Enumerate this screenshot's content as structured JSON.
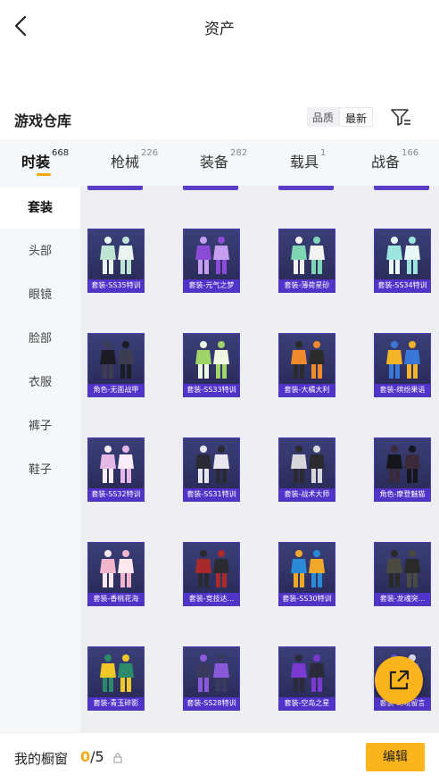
{
  "header": {
    "title": "资产",
    "back_icon": "chevron-left-icon"
  },
  "warehouse": {
    "title": "游戏仓库",
    "sort_options": [
      "品质",
      "最新"
    ],
    "active_sort": "最新",
    "filter_icon": "filter-icon"
  },
  "tabs": [
    {
      "label": "时装",
      "count": "668",
      "active": true
    },
    {
      "label": "枪械",
      "count": "226",
      "active": false
    },
    {
      "label": "装备",
      "count": "282",
      "active": false
    },
    {
      "label": "载具",
      "count": "1",
      "active": false
    },
    {
      "label": "战备",
      "count": "166",
      "active": false
    }
  ],
  "sidebar": {
    "items": [
      {
        "label": "套装",
        "active": true
      },
      {
        "label": "头部"
      },
      {
        "label": "眼镜"
      },
      {
        "label": "脸部"
      },
      {
        "label": "衣服"
      },
      {
        "label": "裤子"
      },
      {
        "label": "鞋子"
      }
    ]
  },
  "items": [
    {
      "label": "套装-SS35特训",
      "palette": [
        "#bfe4d4",
        "#e9f4f0"
      ]
    },
    {
      "label": "套装-元气之梦",
      "palette": [
        "#8b4bd6",
        "#c69ef0"
      ]
    },
    {
      "label": "套装-薄荷星砂",
      "palette": [
        "#7ed6b4",
        "#f2f2f2"
      ]
    },
    {
      "label": "套装-SS34特训",
      "palette": [
        "#9be7e0",
        "#e8f8f6"
      ]
    },
    {
      "label": "角色-无面战甲",
      "palette": [
        "#1c1c24",
        "#3c3c52"
      ]
    },
    {
      "label": "套装-SS33特训",
      "palette": [
        "#9fd46a",
        "#eef6e4"
      ]
    },
    {
      "label": "套装-大橘大利",
      "palette": [
        "#f08a2a",
        "#2b2b2b"
      ]
    },
    {
      "label": "套装-缤纷果语",
      "palette": [
        "#f4b42a",
        "#3a78d8"
      ]
    },
    {
      "label": "套装-SS32特训",
      "palette": [
        "#e6b8e6",
        "#fbeefb"
      ]
    },
    {
      "label": "套装-SS31特训",
      "palette": [
        "#2a2a34",
        "#e8e8ee"
      ]
    },
    {
      "label": "套装-战术大师",
      "palette": [
        "#d8d8dc",
        "#2a2a30"
      ]
    },
    {
      "label": "角色-摩登魅猫",
      "palette": [
        "#15151c",
        "#3a2a3a"
      ]
    },
    {
      "label": "套装-香桃花海",
      "palette": [
        "#f2b6cc",
        "#fde8f0"
      ]
    },
    {
      "label": "套装-竞技达...",
      "palette": [
        "#a82a2a",
        "#2a2a30"
      ]
    },
    {
      "label": "套装-SS30特训",
      "palette": [
        "#2a8ad8",
        "#f0a828"
      ]
    },
    {
      "label": "套装-龙魂突...",
      "palette": [
        "#4a4a40",
        "#2a2a28"
      ]
    },
    {
      "label": "套装-青玉碎影",
      "palette": [
        "#f0c828",
        "#2a8a6a"
      ]
    },
    {
      "label": "套装-SS28特训",
      "palette": [
        "#3a3a60",
        "#8a5ad8"
      ]
    },
    {
      "label": "套装-空岛之星",
      "palette": [
        "#7a3ad0",
        "#2a2a3a"
      ]
    },
    {
      "label": "套装-幻境留言",
      "palette": [
        "#d8d8e8",
        "#5a5ad0"
      ]
    }
  ],
  "bottom": {
    "label": "我的橱窗",
    "current": "0",
    "total": "/5",
    "lock_icon": "lock-icon",
    "edit_label": "编辑",
    "share_icon": "external-share-icon"
  },
  "colors": {
    "accent": "#fbb41b",
    "card_label": "#5133c9",
    "card_bg": "#2a2e5c"
  }
}
